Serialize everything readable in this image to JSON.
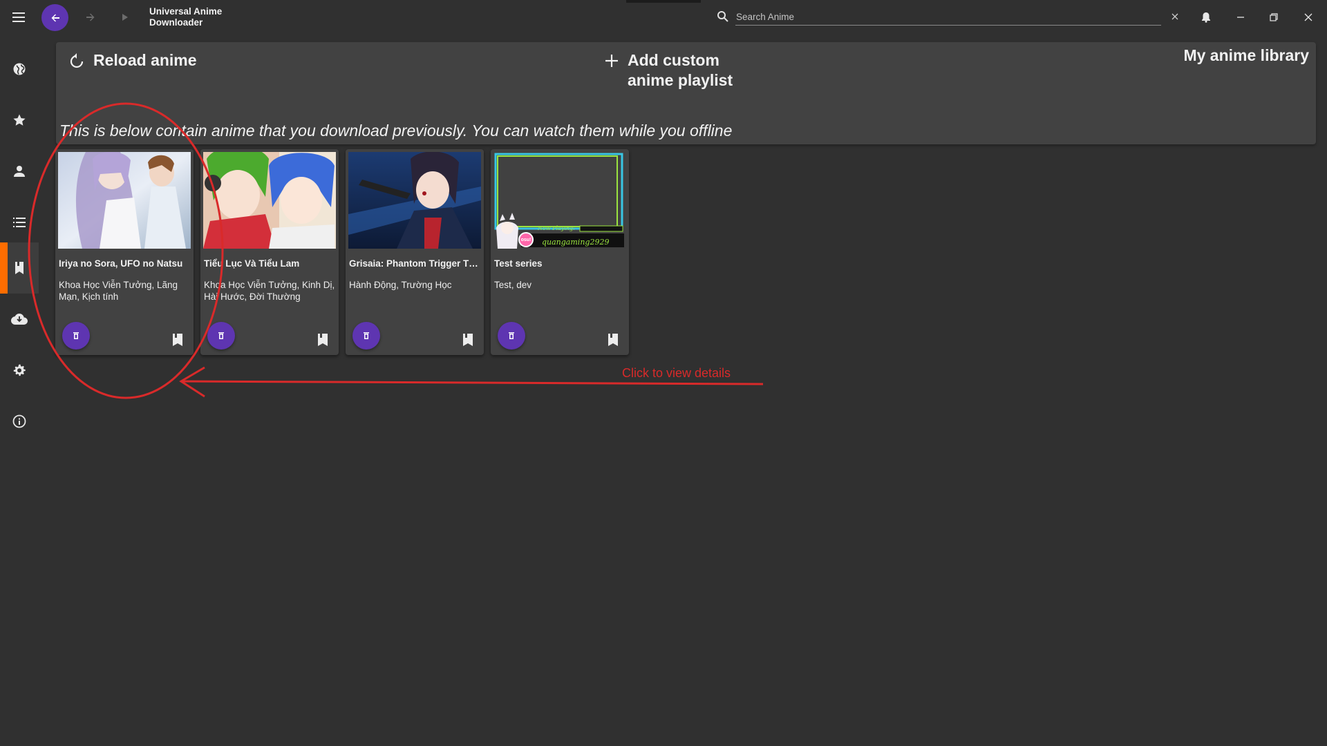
{
  "app": {
    "title": "Universal Anime\nDownloader"
  },
  "titlebar": {
    "icons": [
      "menu-icon",
      "arrow-back-icon",
      "arrow-forward-icon",
      "play-icon"
    ],
    "search": {
      "placeholder": "Search Anime",
      "value": ""
    },
    "actions": [
      "close-small-icon",
      "bell-icon",
      "minimize-icon",
      "restore-icon",
      "close-icon"
    ]
  },
  "sidebar": {
    "items": [
      {
        "icon": "globe-icon"
      },
      {
        "icon": "star-icon"
      },
      {
        "icon": "person-icon"
      },
      {
        "icon": "list-icon"
      },
      {
        "icon": "bookmark-icon",
        "active": true
      },
      {
        "icon": "cloud-download-icon"
      },
      {
        "icon": "gear-icon"
      },
      {
        "icon": "info-icon"
      }
    ]
  },
  "header": {
    "reload_label": "Reload anime",
    "add_label": "Add custom\nanime playlist",
    "library_title": "My anime library",
    "description": "This is below contain anime that you download previously. You can watch them while you offline"
  },
  "cards": [
    {
      "title": "Iriya no Sora, UFO no Natsu",
      "genres": "Khoa Học Viễn Tưởng, Lãng Mạn, Kịch tính"
    },
    {
      "title": "Tiểu Lục Và Tiểu Lam",
      "genres": "Khoa Học Viễn Tưởng, Kinh Dị, Hài Hước, Đời Thường"
    },
    {
      "title": "Grisaia: Phantom Trigger Th...",
      "genres": "Hành Động, Trường Học"
    },
    {
      "title": "Test series",
      "genres": "Test, dev"
    }
  ],
  "thumb3": {
    "banner_text": "Now Playing:",
    "username": "quangaming2929",
    "badge": "osu!"
  },
  "annotation": {
    "text": "Click to view details"
  },
  "colors": {
    "background": "#303030",
    "panel": "#424242",
    "accent_purple": "#5e35b1",
    "active_indicator": "#ff6d00",
    "annotation_red": "#d92a2a"
  }
}
